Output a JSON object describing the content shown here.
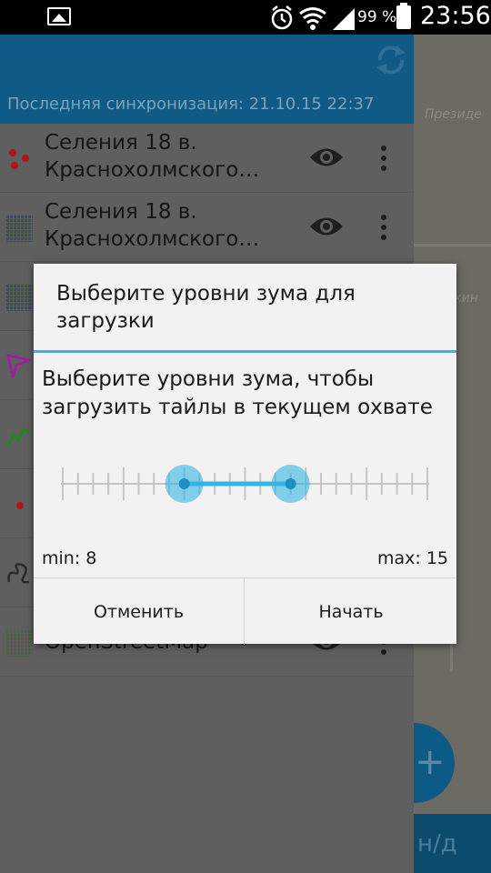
{
  "status_bar": {
    "battery": "99 %",
    "time": "23:56",
    "icons": [
      "image-icon",
      "alarm-icon",
      "wifi-icon",
      "signal-icon",
      "battery-icon"
    ]
  },
  "drawer": {
    "last_sync": "Последняя синхронизация: 21.10.15 22:37",
    "layers": [
      {
        "name": "Селения 18 в. Краснохолмского…",
        "icon": "points-layer-icon"
      },
      {
        "name": "Селения 18 в. Краснохолмского…",
        "icon": "raster-layer-icon"
      },
      {
        "name": "",
        "icon": "raster-layer-icon"
      },
      {
        "name": "",
        "icon": "polygon-layer-icon"
      },
      {
        "name": "",
        "icon": "line-layer-icon"
      },
      {
        "name": "",
        "icon": "point-layer-icon"
      },
      {
        "name": "",
        "icon": "track-layer-icon"
      },
      {
        "name": "OpenStreetMap",
        "icon": "raster-layer-icon"
      }
    ]
  },
  "map": {
    "label_top": "Президе",
    "label_mid": "жин",
    "bottom_text": "н/д"
  },
  "dialog": {
    "title": "Выберите уровни зума для загрузки",
    "message": "Выберите уровни зума, чтобы загрузить тайлы в текущем охвате",
    "zoom_min": 8,
    "zoom_max": 15,
    "min_label": "min: 8",
    "max_label": "max: 15",
    "cancel_label": "Отменить",
    "start_label": "Начать"
  },
  "colors": {
    "accent": "#33b5e5",
    "header": "#0f5b85",
    "dialog_bg": "#f2f2f2"
  }
}
